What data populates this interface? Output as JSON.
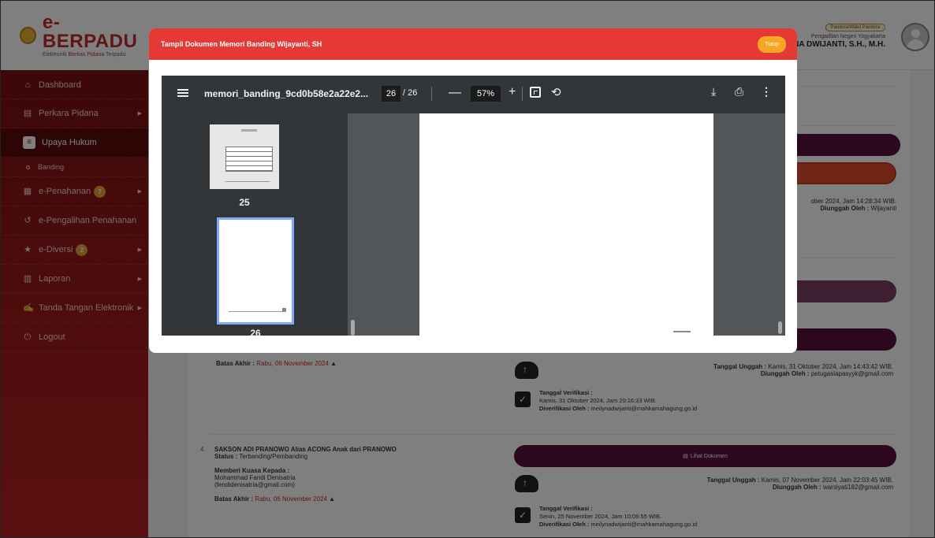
{
  "header": {
    "logo_title": "e-BERPADU",
    "logo_subtitle_prefix": "Elektronik ",
    "logo_subtitle_accent": "Berkas Pidana",
    "logo_subtitle_suffix": " Terpadu",
    "user_role": "Panitera/Wakil Panitera",
    "user_court": "Pengadilan Negeri Yogyakarta",
    "user_name": "NA DWIJANTI, S.H., M.H."
  },
  "sidebar": {
    "items": [
      {
        "label": "Dashboard",
        "icon": "home-icon"
      },
      {
        "label": "Perkara Pidana",
        "icon": "folder-icon"
      },
      {
        "label": "Upaya Hukum",
        "icon": "document-icon"
      },
      {
        "label": "Banding",
        "icon": "circle-icon"
      },
      {
        "label": "e-Penahanan",
        "icon": "grid-icon",
        "badge": "7"
      },
      {
        "label": "e-Pengalihan Penahanan",
        "icon": "history-icon"
      },
      {
        "label": "e-Diversi",
        "icon": "star-icon",
        "badge": "2"
      },
      {
        "label": "Laporan",
        "icon": "chart-icon"
      },
      {
        "label": "Tanda Tangan Elektronik",
        "icon": "signature-icon"
      },
      {
        "label": "Logout",
        "icon": "power-icon"
      }
    ]
  },
  "modal": {
    "title": "Tampil Dokumen Memori Banding Wijayanti, SH",
    "close_label": "Tutup"
  },
  "pdf": {
    "filename": "memori_banding_9cd0b58e2a22e2...",
    "current_page": "26",
    "total_pages": "/ 26",
    "zoom": "57%",
    "thumbnails": [
      {
        "label": "25"
      },
      {
        "label": "26"
      }
    ]
  },
  "background": {
    "entry3": {
      "upload_line1": "ober 2024, Jam 14:28:34 WIB.",
      "upload_by_label": "Diunggah Oleh :",
      "upload_by_value": "Wijayanti",
      "deadline_label": "Batas Akhir :",
      "deadline_value": "Rabu, 06 November 2024",
      "upload2_label": "Tanggal Unggah :",
      "upload2_value": "Kamis, 31 Oktober 2024, Jam 14:43:42 WIB.",
      "upload2_by_label": "Diunggah Oleh :",
      "upload2_by_value": "petugaslapasyyk@gmail.com",
      "verif_label": "Tanggal Verifikasi :",
      "verif_value": "Kamis, 31 Oktober 2024, Jam 20:16:33 WIB.",
      "verif_by_label": "Diverifikasi Oleh :",
      "verif_by_value": "meilynadwijanti@mahkamahagung.go.id"
    },
    "entry4": {
      "number": "4",
      "name": "SAKSON ADI PRANOWO Alias ACONG Anak dari PRANOWO",
      "status_label": "Status :",
      "status_value": "Terbanding/Pembanding",
      "kuasa_label": "Memberi Kuasa Kepada :",
      "kuasa_name": "Mohammad Fandi Denisatria",
      "kuasa_email": "(fendidenisatria@gmail.com)",
      "deadline_label": "Batas Akhir :",
      "deadline_value": "Rabu, 06 November 2024",
      "view_doc_label": "Lihat Dokumen",
      "upload_label": "Tanggal Unggah :",
      "upload_value": "Kamis, 07 November 2024, Jam 22:03:45 WIB.",
      "upload_by_label": "Diunggah Oleh :",
      "upload_by_value": "warsiyati182@gmail.com",
      "verif_label": "Tanggal Verifikasi :",
      "verif_value": "Senin, 25 November 2024, Jam 10:09:55 WIB.",
      "verif_by_label": "Diverifikasi Oleh :",
      "verif_by_value": "meilynadwijanti@mahkamahagung.go.id"
    }
  }
}
